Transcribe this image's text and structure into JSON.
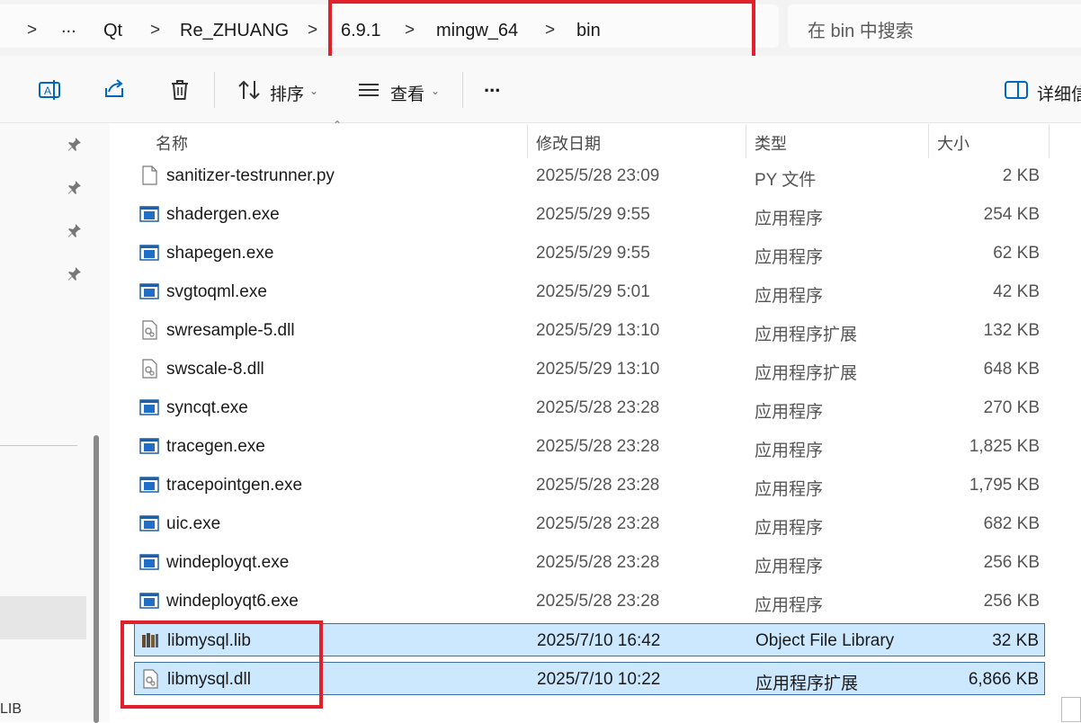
{
  "address": {
    "crumbs": [
      "...",
      "Qt",
      "Re_ZHUANG",
      "6.9.1",
      "mingw_64",
      "bin"
    ],
    "chevron": ">"
  },
  "search": {
    "placeholder": "在 bin 中搜索"
  },
  "toolbar": {
    "sort_label": "排序",
    "view_label": "查看",
    "more_label": "...",
    "details_label": "详细信"
  },
  "columns": {
    "name": "名称",
    "date": "修改日期",
    "type": "类型",
    "size": "大小"
  },
  "files": [
    {
      "name": "sanitizer-testrunner.py",
      "date": "2025/5/28 23:09",
      "type": "PY 文件",
      "size": "2 KB",
      "icon": "file-icon",
      "selected": false
    },
    {
      "name": "shadergen.exe",
      "date": "2025/5/29 9:55",
      "type": "应用程序",
      "size": "254 KB",
      "icon": "exe-icon",
      "selected": false
    },
    {
      "name": "shapegen.exe",
      "date": "2025/5/29 9:55",
      "type": "应用程序",
      "size": "62 KB",
      "icon": "exe-icon",
      "selected": false
    },
    {
      "name": "svgtoqml.exe",
      "date": "2025/5/29 5:01",
      "type": "应用程序",
      "size": "42 KB",
      "icon": "exe-icon",
      "selected": false
    },
    {
      "name": "swresample-5.dll",
      "date": "2025/5/29 13:10",
      "type": "应用程序扩展",
      "size": "132 KB",
      "icon": "dll-icon",
      "selected": false
    },
    {
      "name": "swscale-8.dll",
      "date": "2025/5/29 13:10",
      "type": "应用程序扩展",
      "size": "648 KB",
      "icon": "dll-icon",
      "selected": false
    },
    {
      "name": "syncqt.exe",
      "date": "2025/5/28 23:28",
      "type": "应用程序",
      "size": "270 KB",
      "icon": "exe-icon",
      "selected": false
    },
    {
      "name": "tracegen.exe",
      "date": "2025/5/28 23:28",
      "type": "应用程序",
      "size": "1,825 KB",
      "icon": "exe-icon",
      "selected": false
    },
    {
      "name": "tracepointgen.exe",
      "date": "2025/5/28 23:28",
      "type": "应用程序",
      "size": "1,795 KB",
      "icon": "exe-icon",
      "selected": false
    },
    {
      "name": "uic.exe",
      "date": "2025/5/28 23:28",
      "type": "应用程序",
      "size": "682 KB",
      "icon": "exe-icon",
      "selected": false
    },
    {
      "name": "windeployqt.exe",
      "date": "2025/5/28 23:28",
      "type": "应用程序",
      "size": "256 KB",
      "icon": "exe-icon",
      "selected": false
    },
    {
      "name": "windeployqt6.exe",
      "date": "2025/5/28 23:28",
      "type": "应用程序",
      "size": "256 KB",
      "icon": "exe-icon",
      "selected": false
    },
    {
      "name": "libmysql.lib",
      "date": "2025/7/10 16:42",
      "type": "Object File Library",
      "size": "32 KB",
      "icon": "lib-icon",
      "selected": true
    },
    {
      "name": "libmysql.dll",
      "date": "2025/7/10 10:22",
      "type": "应用程序扩展",
      "size": "6,866 KB",
      "icon": "dll-icon",
      "selected": true
    }
  ],
  "status": {
    "text": "LIB"
  },
  "colors": {
    "selection": "#cce8ff",
    "highlight_box": "#e0202a",
    "accent": "#0067c0"
  }
}
